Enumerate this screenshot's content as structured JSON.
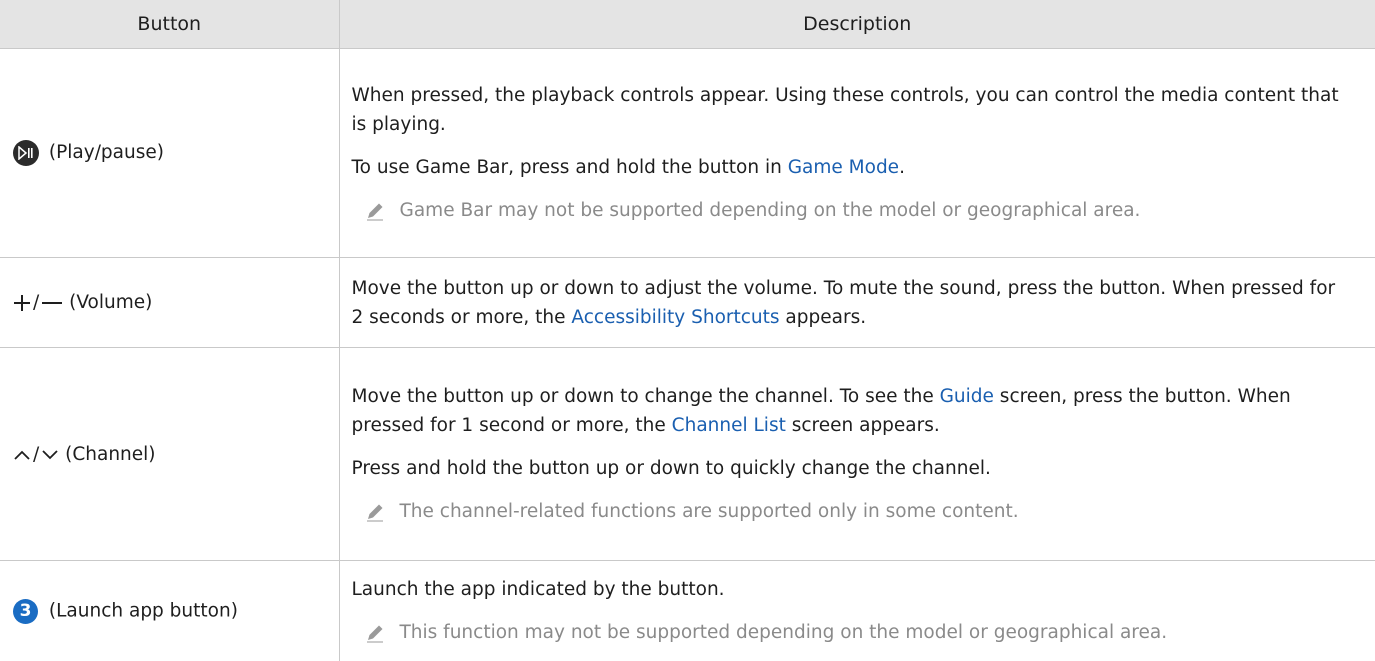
{
  "header": {
    "button": "Button",
    "description": "Description"
  },
  "rows": [
    {
      "button_label": "(Play/pause)",
      "paragraphs": [
        "When pressed, the playback controls appear. Using these controls, you can control the media content that is playing."
      ],
      "p2_pre": "To use Game Bar, press and hold the button in ",
      "p2_link": "Game Mode",
      "p2_post": ".",
      "note": "Game Bar may not be supported depending on the model or geographical area."
    },
    {
      "button_label": "(Volume)",
      "p1_pre": "Move the button up or down to adjust the volume. To mute the sound, press the button. When pressed for 2 seconds or more, the ",
      "p1_link": "Accessibility Shortcuts",
      "p1_post": " appears."
    },
    {
      "button_label": "(Channel)",
      "p1_pre": "Move the button up or down to change the channel. To see the ",
      "p1_link1": "Guide",
      "p1_mid": " screen, press the button. When pressed for 1 second or more, the ",
      "p1_link2": "Channel List",
      "p1_post": " screen appears.",
      "p2": "Press and hold the button up or down to quickly change the channel.",
      "note": "The channel-related functions are supported only in some content."
    },
    {
      "button_number": "3",
      "button_label": "(Launch app button)",
      "p1": "Launch the app indicated by the button.",
      "note": "This function may not be supported depending on the model or geographical area."
    }
  ],
  "colors": {
    "link": "#1a5fb0",
    "note": "#8a8a8a",
    "header_bg": "#e4e4e4",
    "badge": "#1a6cc3"
  },
  "icons": [
    "play-pause-icon",
    "plus-icon",
    "minus-icon",
    "chevron-up-icon",
    "chevron-down-icon",
    "number-3-icon",
    "pencil-note-icon"
  ]
}
